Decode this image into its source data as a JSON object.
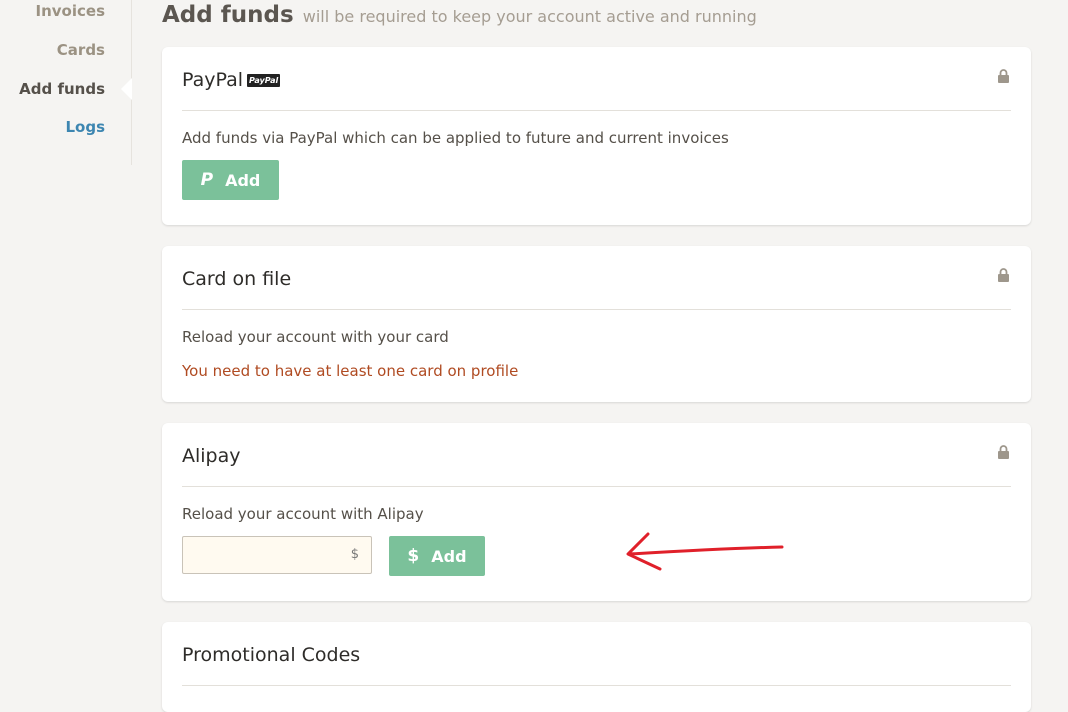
{
  "sidebar": {
    "items": [
      {
        "label": "Invoices"
      },
      {
        "label": "Cards"
      },
      {
        "label": "Add funds"
      },
      {
        "label": "Logs"
      }
    ]
  },
  "header": {
    "title": "Add funds",
    "subtitle": "will be required to keep your account active and running"
  },
  "paypal": {
    "title": "PayPal",
    "badge": "PayPal",
    "description": "Add funds via PayPal which can be applied to future and current invoices",
    "button_icon": "P",
    "button_label": "Add"
  },
  "card_on_file": {
    "title": "Card on file",
    "description": "Reload your account with your card",
    "warning": "You need to have at least one card on profile"
  },
  "alipay": {
    "title": "Alipay",
    "description": "Reload your account with Alipay",
    "amount_value": "",
    "currency": "$",
    "button_icon": "$",
    "button_label": "Add"
  },
  "promo": {
    "title": "Promotional Codes"
  },
  "colors": {
    "accent_green": "#7bc19a",
    "link_blue": "#3d86b1",
    "warning": "#b04b22",
    "annotation_red": "#e0202a"
  },
  "icons": {
    "lock": "lock-icon",
    "paypal_p": "paypal-icon",
    "dollar": "dollar-icon"
  }
}
